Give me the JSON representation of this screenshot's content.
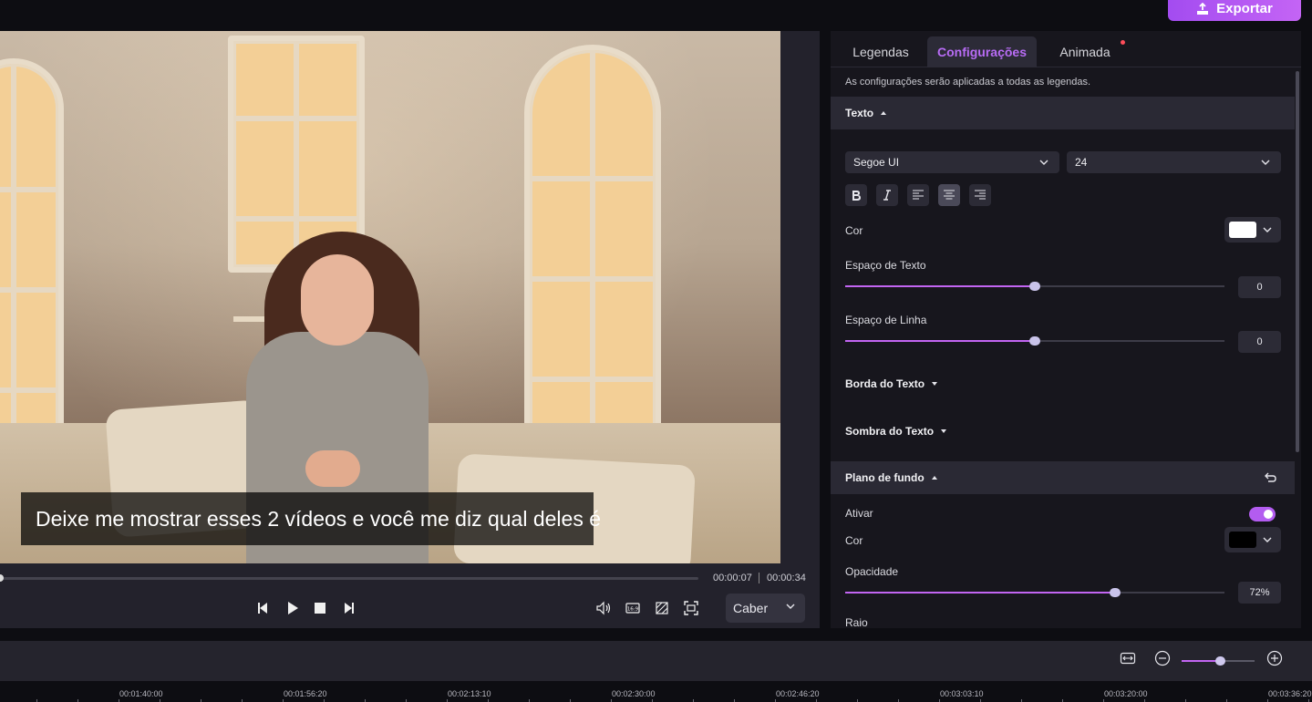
{
  "header": {
    "export_label": "Exportar"
  },
  "preview": {
    "subtitle_text": "Deixe me mostrar esses 2 vídeos e você me diz qual deles é",
    "current_time": "00:00:07",
    "total_time": "00:00:34",
    "progress": 0.0,
    "fit_option": "Caber"
  },
  "panel": {
    "tabs": [
      {
        "label": "Legendas"
      },
      {
        "label": "Configurações",
        "active": true
      },
      {
        "label": "Animada",
        "has_notification": true
      }
    ],
    "note": "As configurações serão aplicadas a todas as legendas.",
    "text_section": {
      "title": "Texto",
      "font": "Segoe UI",
      "size": "24",
      "format_buttons": [
        "bold-icon",
        "italic-icon",
        "align-left-icon",
        "align-center-icon",
        "align-right-icon"
      ],
      "active_align": "center",
      "color_label": "Cor",
      "color": "#ffffff",
      "text_spacing_label": "Espaço de Texto",
      "text_spacing_value": "0",
      "text_spacing_slider": 0.5,
      "line_spacing_label": "Espaço de Linha",
      "line_spacing_value": "0",
      "line_spacing_slider": 0.5,
      "border_label": "Borda do Texto",
      "shadow_label": "Sombra do Texto"
    },
    "background_section": {
      "title": "Plano de fundo",
      "enable_label": "Ativar",
      "enabled": true,
      "color_label": "Cor",
      "color": "#000000",
      "opacity_label": "Opacidade",
      "opacity_value": "72%",
      "opacity_slider": 0.72,
      "radius_label": "Raio"
    }
  },
  "timeline": {
    "zoom_level": 0.54,
    "ruler_labels": [
      "00:01:40:00",
      "00:01:56:20",
      "00:02:13:10",
      "00:02:30:00",
      "00:02:46:20",
      "00:03:03:10",
      "00:03:20:00",
      "00:03:36:20"
    ]
  },
  "colors": {
    "accent": "#b35cf0",
    "panel_bg": "#17161d"
  }
}
